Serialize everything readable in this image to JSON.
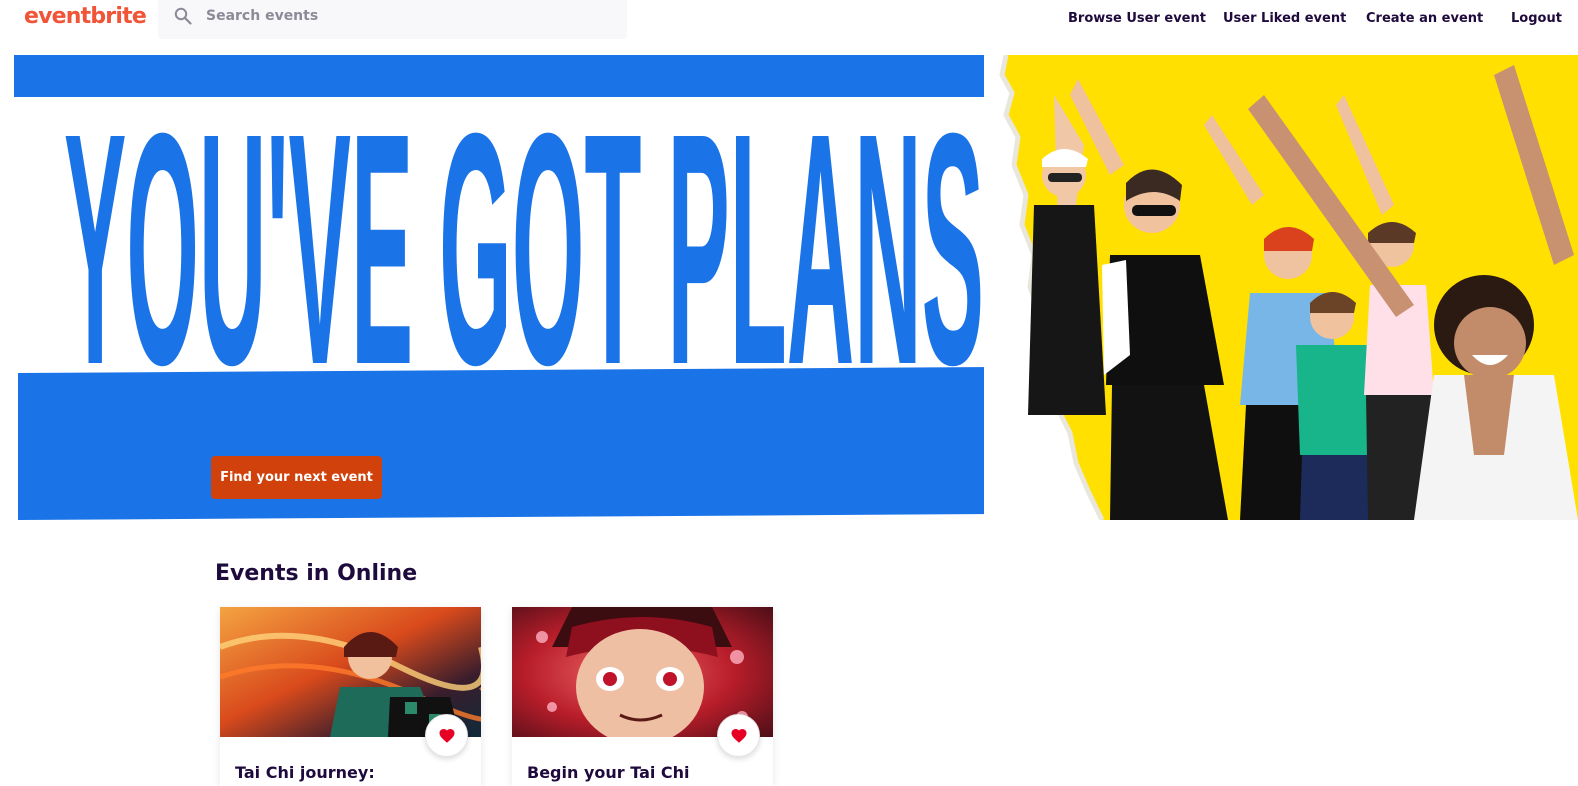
{
  "brand": {
    "logo_text": "eventbrite",
    "accent_color": "#d1410c",
    "logo_color": "#f05537"
  },
  "search": {
    "placeholder": "Search events",
    "value": ""
  },
  "nav": {
    "browse_label": "Browse User event",
    "liked_label": "User Liked event",
    "create_label": "Create an event",
    "logout_label": "Logout"
  },
  "hero": {
    "headline": "YOU'VE GOT PLANS",
    "cta_label": "Find your next event",
    "colors": {
      "blue": "#1b73e8",
      "yellow": "#ffe000",
      "cta": "#d1410c"
    }
  },
  "events_section": {
    "title": "Events in Online",
    "cards": [
      {
        "title": "Tai Chi journey:",
        "image_icon": "anime-fire-scene-image",
        "like_icon": "heart-icon"
      },
      {
        "title": "Begin your Tai Chi",
        "image_icon": "anime-portrait-image",
        "like_icon": "heart-icon"
      }
    ]
  }
}
